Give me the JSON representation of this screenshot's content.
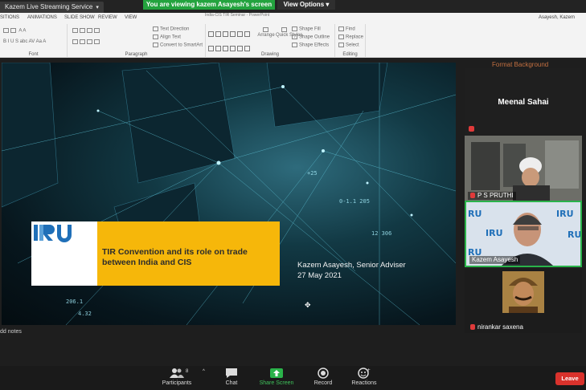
{
  "topbar": {
    "tab_label": "Kazem Live Streaming Service",
    "viewing_banner": "You are viewing kazem Asayesh's screen",
    "view_options": "View Options"
  },
  "ribbon": {
    "file_title": "India-CIS TIR Seminar - PowerPoint",
    "user": "Asayesh, Kazem",
    "tabs": [
      "SITIONS",
      "ANIMATIONS",
      "SLIDE SHOW",
      "REVIEW",
      "VIEW"
    ],
    "groups": {
      "font": "Font",
      "paragraph": "Paragraph",
      "drawing": "Drawing",
      "editing": "Editing"
    },
    "buttons": {
      "text_direction": "Text Direction",
      "align_text": "Align Text",
      "convert_smartart": "Convert to SmartArt",
      "arrange": "Arrange",
      "quick_styles": "Quick Styles",
      "shape_fill": "Shape Fill",
      "shape_outline": "Shape Outline",
      "shape_effects": "Shape Effects",
      "find": "Find",
      "replace": "Replace",
      "select": "Select"
    }
  },
  "slide": {
    "logo_text": "IRU",
    "title_line1": "TIR Convention and its role on trade",
    "title_line2": "between India and CIS",
    "presenter_line1": "Kazem Asayesh, Senior Adviser",
    "presenter_line2": "27 May 2021",
    "add_notes": "dd notes",
    "format_background": "Format Background"
  },
  "participants": [
    {
      "name": "Meenal Sahai",
      "muted": true
    },
    {
      "name": "P S PRUTHI",
      "muted": true
    },
    {
      "name": "Kazem Asayesh",
      "muted": false
    },
    {
      "name": "nirankar saxena",
      "muted": true
    }
  ],
  "toolbar": {
    "participants_label": "Participants",
    "participants_count": "8",
    "chat_label": "Chat",
    "share_label": "Share Screen",
    "record_label": "Record",
    "reactions_label": "Reactions",
    "leave_label": "Leave"
  },
  "colors": {
    "share_green": "#2ab34a",
    "leave_red": "#d9322c",
    "title_yellow": "#f6b70a",
    "iru_blue": "#1f6fb8"
  }
}
